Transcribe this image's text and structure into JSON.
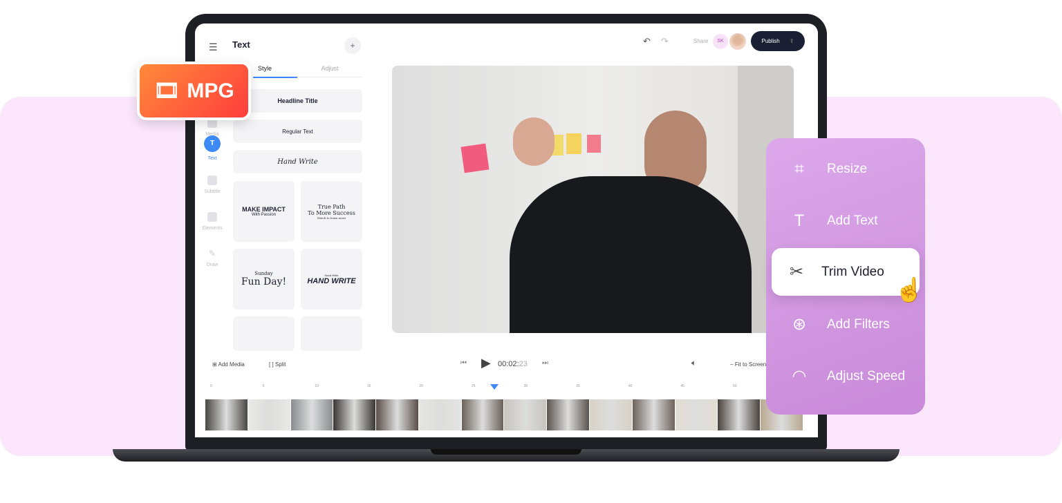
{
  "panel_header": {
    "title": "Text",
    "add": "+"
  },
  "tabs": [
    {
      "label": "Style"
    },
    {
      "label": "Adjust"
    }
  ],
  "sidebar": [
    {
      "label": "Media"
    },
    {
      "label": "Text"
    },
    {
      "label": "Subtitle"
    },
    {
      "label": "Elements"
    },
    {
      "label": "Draw"
    }
  ],
  "text_styles": {
    "headline": "Headline Title",
    "regular": "Regular Text",
    "hand": "Hand Write",
    "impact_1": "MAKE IMPACT",
    "impact_2": "With Passion",
    "path_1": "True Path",
    "path_2": "To More Success",
    "path_3": "Watch to learn more",
    "fun_1": "Sunday",
    "fun_2": "Fun Day!",
    "hw_1": "Hand Write",
    "hw_2": "HAND WRITE"
  },
  "topbar": {
    "share": "Share",
    "avatar_initials": "SK",
    "publish": "Publish"
  },
  "toolbar": {
    "add_media": "Add Media",
    "split": "Split",
    "time_main": "00:02:",
    "time_frames": "23",
    "fit": "Fit to Screen"
  },
  "ruler": [
    "0",
    "5",
    "10",
    "15",
    "20",
    "25",
    "30",
    "35",
    "40",
    "45",
    "50"
  ],
  "playhead_seconds": 27.2,
  "badge": {
    "label": "MPG"
  },
  "features": [
    {
      "label": "Resize",
      "icon": "crop-icon"
    },
    {
      "label": "Add Text",
      "icon": "text-icon"
    },
    {
      "label": "Trim Video",
      "icon": "scissors-icon"
    },
    {
      "label": "Add Filters",
      "icon": "filters-icon"
    },
    {
      "label": "Adjust Speed",
      "icon": "speedometer-icon"
    }
  ],
  "colors": {
    "accent": "#3d8af7",
    "publish_bg": "#1b1f33",
    "panel": "#d49ae4",
    "badge": "#ff5a3a"
  }
}
